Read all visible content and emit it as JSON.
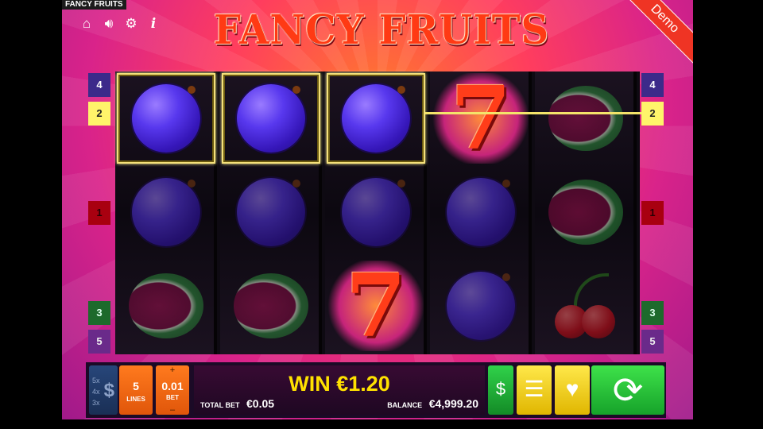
{
  "header": {
    "game_title": "FANCY FRUITS",
    "logo_text": "FANCY FRUITS",
    "demo_label": "Demo",
    "icons": [
      "home-icon",
      "sound-icon",
      "settings-icon",
      "info-icon"
    ]
  },
  "paylines": {
    "left": [
      "4",
      "2",
      "1",
      "3",
      "5"
    ],
    "right": [
      "4",
      "2",
      "1",
      "3",
      "5"
    ]
  },
  "reels": [
    [
      "plum",
      "plum",
      "melon"
    ],
    [
      "plum",
      "plum",
      "melon"
    ],
    [
      "plum",
      "plum",
      "seven"
    ],
    [
      "seven",
      "plum",
      "plum"
    ],
    [
      "melon",
      "melon",
      "cherry"
    ]
  ],
  "winning_symbols": [
    [
      0,
      0
    ],
    [
      1,
      0
    ],
    [
      2,
      0
    ]
  ],
  "hud": {
    "lines_value": "5",
    "lines_label": "LINES",
    "bet_value": "0.01",
    "bet_label": "BET",
    "bet_plus": "+",
    "bet_minus": "–",
    "paytable_marks": [
      "5x",
      "4x",
      "3x"
    ],
    "paytable_symbol": "$",
    "win_text": "WIN €1.20",
    "total_bet_label": "TOTAL BET",
    "total_bet_value": "€0.05",
    "balance_label": "BALANCE",
    "balance_value": "€4,999.20"
  },
  "colors": {
    "win_yellow": "#ffe100",
    "spin_green": "#16a22a",
    "orange_button": "#ff7a1e"
  }
}
